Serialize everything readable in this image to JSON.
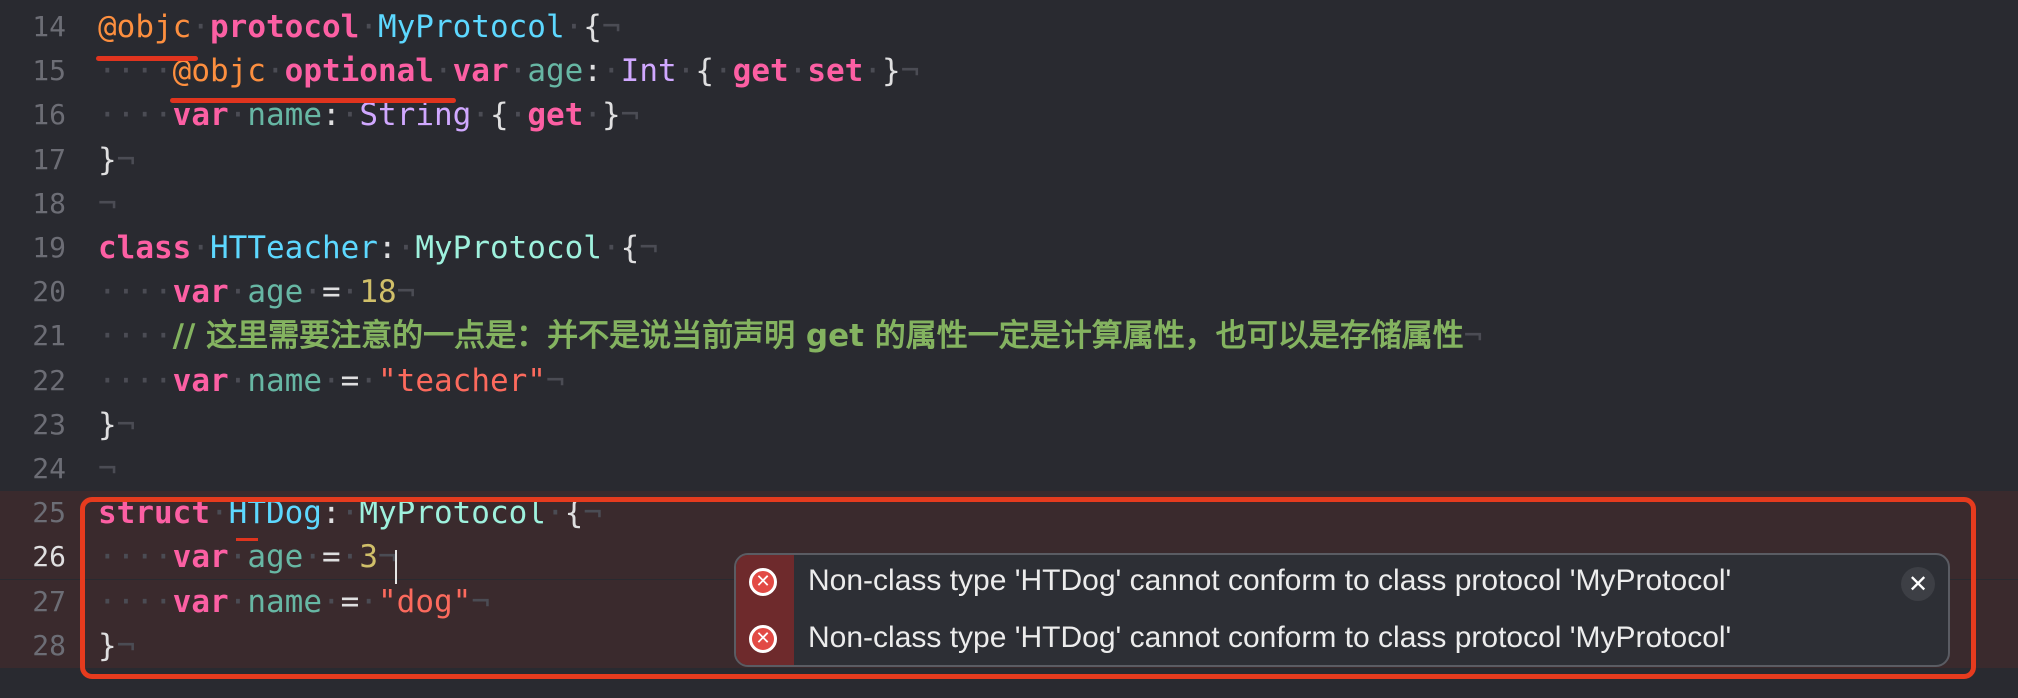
{
  "editor": {
    "lines": [
      {
        "no": "14",
        "tokens": [
          {
            "c": "attr",
            "t": "@objc"
          },
          {
            "c": "inv",
            "t": "·"
          },
          {
            "c": "kw",
            "t": "protocol"
          },
          {
            "c": "inv",
            "t": "·"
          },
          {
            "c": "type-decl",
            "t": "MyProtocol"
          },
          {
            "c": "inv",
            "t": "·"
          },
          {
            "c": "plain",
            "t": "{"
          },
          {
            "c": "inv",
            "t": "¬"
          }
        ]
      },
      {
        "no": "15",
        "tokens": [
          {
            "c": "inv",
            "t": "····"
          },
          {
            "c": "attr",
            "t": "@objc"
          },
          {
            "c": "inv",
            "t": "·"
          },
          {
            "c": "kw",
            "t": "optional"
          },
          {
            "c": "inv",
            "t": "·"
          },
          {
            "c": "kw",
            "t": "var"
          },
          {
            "c": "inv",
            "t": "·"
          },
          {
            "c": "prop",
            "t": "age"
          },
          {
            "c": "plain",
            "t": ":"
          },
          {
            "c": "inv",
            "t": "·"
          },
          {
            "c": "type-sys",
            "t": "Int"
          },
          {
            "c": "inv",
            "t": "·"
          },
          {
            "c": "plain",
            "t": "{"
          },
          {
            "c": "inv",
            "t": "·"
          },
          {
            "c": "kw",
            "t": "get"
          },
          {
            "c": "inv",
            "t": "·"
          },
          {
            "c": "kw",
            "t": "set"
          },
          {
            "c": "inv",
            "t": "·"
          },
          {
            "c": "plain",
            "t": "}"
          },
          {
            "c": "inv",
            "t": "¬"
          }
        ]
      },
      {
        "no": "16",
        "tokens": [
          {
            "c": "inv",
            "t": "····"
          },
          {
            "c": "kw",
            "t": "var"
          },
          {
            "c": "inv",
            "t": "·"
          },
          {
            "c": "prop",
            "t": "name"
          },
          {
            "c": "plain",
            "t": ":"
          },
          {
            "c": "inv",
            "t": "·"
          },
          {
            "c": "type-sys",
            "t": "String"
          },
          {
            "c": "inv",
            "t": "·"
          },
          {
            "c": "plain",
            "t": "{"
          },
          {
            "c": "inv",
            "t": "·"
          },
          {
            "c": "kw",
            "t": "get"
          },
          {
            "c": "inv",
            "t": "·"
          },
          {
            "c": "plain",
            "t": "}"
          },
          {
            "c": "inv",
            "t": "¬"
          }
        ]
      },
      {
        "no": "17",
        "tokens": [
          {
            "c": "plain",
            "t": "}"
          },
          {
            "c": "inv",
            "t": "¬"
          }
        ]
      },
      {
        "no": "18",
        "tokens": [
          {
            "c": "inv",
            "t": "¬"
          }
        ]
      },
      {
        "no": "19",
        "tokens": [
          {
            "c": "kw",
            "t": "class"
          },
          {
            "c": "inv",
            "t": "·"
          },
          {
            "c": "type-decl",
            "t": "HTTeacher"
          },
          {
            "c": "plain",
            "t": ":"
          },
          {
            "c": "inv",
            "t": "·"
          },
          {
            "c": "type-ref",
            "t": "MyProtocol"
          },
          {
            "c": "inv",
            "t": "·"
          },
          {
            "c": "plain",
            "t": "{"
          },
          {
            "c": "inv",
            "t": "¬"
          }
        ]
      },
      {
        "no": "20",
        "tokens": [
          {
            "c": "inv",
            "t": "····"
          },
          {
            "c": "kw",
            "t": "var"
          },
          {
            "c": "inv",
            "t": "·"
          },
          {
            "c": "prop",
            "t": "age"
          },
          {
            "c": "inv",
            "t": "·"
          },
          {
            "c": "plain",
            "t": "="
          },
          {
            "c": "inv",
            "t": "·"
          },
          {
            "c": "num",
            "t": "18"
          },
          {
            "c": "inv",
            "t": "¬"
          }
        ]
      },
      {
        "no": "21",
        "tokens": [
          {
            "c": "inv",
            "t": "····"
          },
          {
            "c": "comment",
            "t": "// 这里需要注意的一点是：并不是说当前声明 get 的属性一定是计算属性，也可以是存储属性"
          },
          {
            "c": "inv",
            "t": "¬"
          }
        ]
      },
      {
        "no": "22",
        "tokens": [
          {
            "c": "inv",
            "t": "····"
          },
          {
            "c": "kw",
            "t": "var"
          },
          {
            "c": "inv",
            "t": "·"
          },
          {
            "c": "prop",
            "t": "name"
          },
          {
            "c": "inv",
            "t": "·"
          },
          {
            "c": "plain",
            "t": "="
          },
          {
            "c": "inv",
            "t": "·"
          },
          {
            "c": "str",
            "t": "\"teacher\""
          },
          {
            "c": "inv",
            "t": "¬"
          }
        ]
      },
      {
        "no": "23",
        "tokens": [
          {
            "c": "plain",
            "t": "}"
          },
          {
            "c": "inv",
            "t": "¬"
          }
        ]
      },
      {
        "no": "24",
        "tokens": [
          {
            "c": "inv",
            "t": "¬"
          }
        ]
      },
      {
        "no": "25",
        "tokens": [
          {
            "c": "kw",
            "t": "struct"
          },
          {
            "c": "inv",
            "t": "·"
          },
          {
            "c": "type-decl",
            "t": "HTDog"
          },
          {
            "c": "plain",
            "t": ":"
          },
          {
            "c": "inv",
            "t": "·"
          },
          {
            "c": "type-ref",
            "t": "MyProtocol"
          },
          {
            "c": "inv",
            "t": "·"
          },
          {
            "c": "plain",
            "t": "{"
          },
          {
            "c": "inv",
            "t": "¬"
          }
        ]
      },
      {
        "no": "26",
        "tokens": [
          {
            "c": "inv",
            "t": "····"
          },
          {
            "c": "kw",
            "t": "var"
          },
          {
            "c": "inv",
            "t": "·"
          },
          {
            "c": "prop",
            "t": "age"
          },
          {
            "c": "inv",
            "t": "·"
          },
          {
            "c": "plain",
            "t": "="
          },
          {
            "c": "inv",
            "t": "·"
          },
          {
            "c": "num",
            "t": "3"
          },
          {
            "c": "inv",
            "t": "¬"
          }
        ]
      },
      {
        "no": "27",
        "tokens": [
          {
            "c": "inv",
            "t": "····"
          },
          {
            "c": "kw",
            "t": "var"
          },
          {
            "c": "inv",
            "t": "·"
          },
          {
            "c": "prop",
            "t": "name"
          },
          {
            "c": "inv",
            "t": "·"
          },
          {
            "c": "plain",
            "t": "="
          },
          {
            "c": "inv",
            "t": "·"
          },
          {
            "c": "str",
            "t": "\"dog\""
          },
          {
            "c": "inv",
            "t": "¬"
          }
        ]
      },
      {
        "no": "28",
        "tokens": [
          {
            "c": "plain",
            "t": "}"
          },
          {
            "c": "inv",
            "t": "¬"
          }
        ]
      }
    ]
  },
  "errors": {
    "messages": [
      "Non-class type 'HTDog' cannot conform to class protocol 'MyProtocol'",
      "Non-class type 'HTDog' cannot conform to class protocol 'MyProtocol'"
    ],
    "close_symbol": "✕",
    "error_symbol": "✕"
  },
  "colors": {
    "background": "#292a30",
    "keyword": "#fc5fa3",
    "attribute": "#fd8f3f",
    "type_declaration": "#5dd8ff",
    "comment": "#84b360",
    "annotation_red": "#e63b1e"
  }
}
